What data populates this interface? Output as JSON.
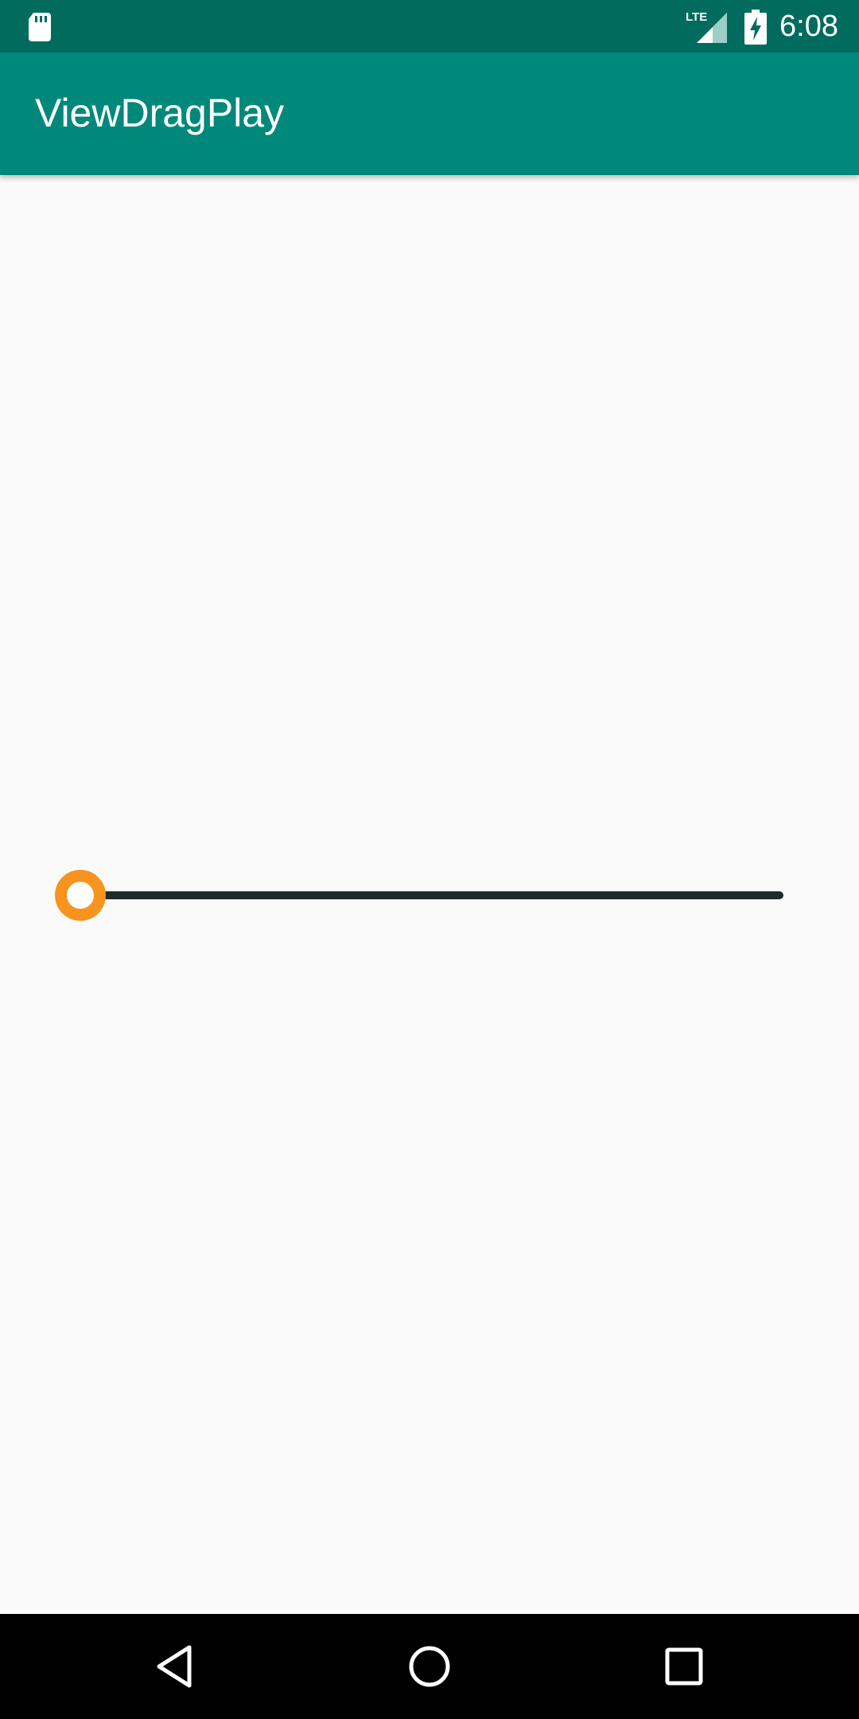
{
  "status_bar": {
    "time": "6:08",
    "network_label": "LTE",
    "icons": [
      "sd-card-icon",
      "lte-signal-icon",
      "battery-charging-icon"
    ]
  },
  "app_bar": {
    "title": "ViewDragPlay"
  },
  "slider": {
    "value_fraction": 0.0,
    "thumb_color": "#f7931e",
    "track_color": "#1f2a2a"
  },
  "nav_bar": {
    "buttons": [
      "back-icon",
      "home-icon",
      "recents-icon"
    ]
  },
  "colors": {
    "status_bar": "#016b5d",
    "app_bar": "#00897b",
    "background": "#fafafa"
  }
}
